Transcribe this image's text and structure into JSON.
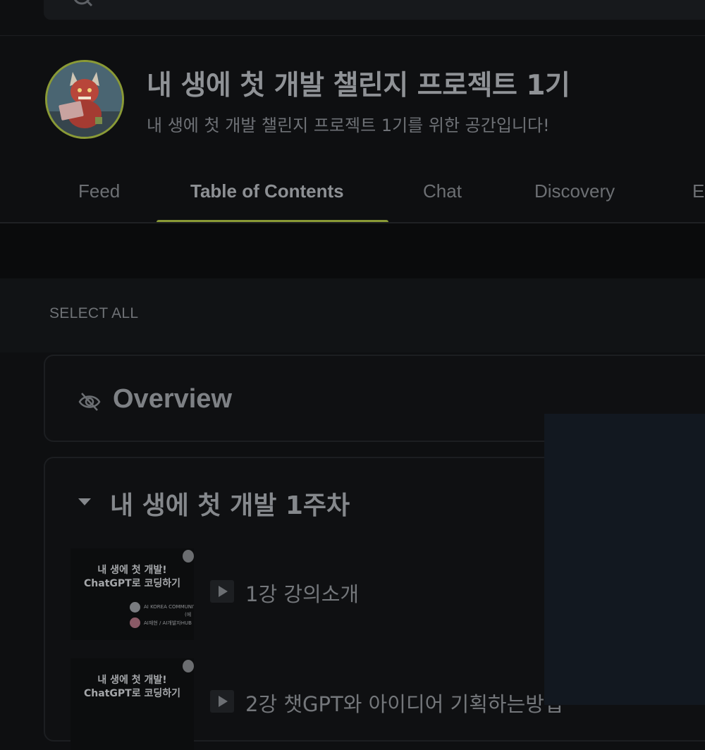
{
  "community": {
    "title": "내 생에 첫 개발 챌린지 프로젝트 1기",
    "subtitle": "내 생에 첫 개발 챌린지 프로젝트 1기를 위한 공간입니다!"
  },
  "tabs": [
    {
      "label": "Feed"
    },
    {
      "label": "Table of Contents",
      "active": true
    },
    {
      "label": "Chat"
    },
    {
      "label": "Discovery"
    },
    {
      "label": "E"
    }
  ],
  "toc": {
    "select_all": "SELECT ALL",
    "overview_title": "Overview",
    "week_title": "내 생에 첫 개발 1주차",
    "thumbnail": {
      "title_line1": "내 생에 첫 개발!",
      "title_line2": "ChatGPT로 코딩하기",
      "credit1": "AI KOREA COMMUNIT",
      "credit1_sub": "(에",
      "credit2": "AI재현 / AI개발자HUB"
    },
    "lessons": [
      {
        "label": "1강 강의소개"
      },
      {
        "label": "2강 챗GPT와 아이디어 기획하는방법"
      }
    ]
  },
  "colors": {
    "accent": "#8a9a36",
    "background": "#0e0f11"
  },
  "icons": {
    "search": "search-icon",
    "overview": "eye-off-icon",
    "collapse": "caret-down-icon",
    "lesson": "play-icon"
  }
}
